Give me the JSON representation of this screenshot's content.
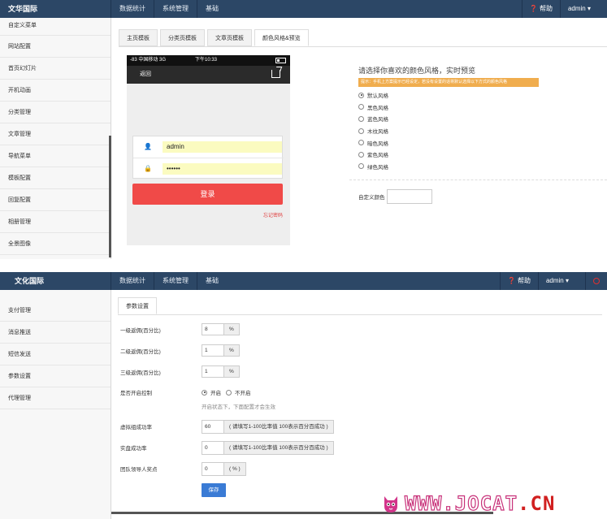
{
  "panel1": {
    "brand": "文华国际",
    "nav": [
      "数据统计",
      "系统管理",
      "基础"
    ],
    "help": "帮助",
    "user": "admin",
    "sidebar": [
      "自定义菜单",
      "网站配置",
      "首页幻灯片",
      "开机动画",
      "分类管理",
      "文章管理",
      "导航菜单",
      "模板配置",
      "回复配置",
      "相册管理",
      "全景图像"
    ],
    "tabs": [
      "主页模板",
      "分类页模板",
      "文章页模板",
      "颜色风格&预览"
    ],
    "phone": {
      "carrier": "-83 中国移动  3G",
      "time": "下午10:33",
      "back": "返回",
      "username": "admin",
      "password": "••••••",
      "login": "登录",
      "forgot": "忘记密码"
    },
    "picker": {
      "title": "请选择你喜欢的颜色风格，实时预览",
      "tip": "提示：手机上方案提示已经设定，若没有设置的话将默认选择以下方式的颜色风格",
      "options": [
        "默认风格",
        "黑色风格",
        "蓝色风格",
        "木纹风格",
        "暗色风格",
        "紫色风格",
        "绿色风格"
      ],
      "selected_index": 0,
      "custom_label": "自定义颜色"
    }
  },
  "panel2": {
    "brand": "文化国际",
    "nav": [
      "数据统计",
      "系统管理",
      "基础"
    ],
    "help": "帮助",
    "user": "admin",
    "sidebar": [
      "支付管理",
      "消息推送",
      "短信发送",
      "参数设置",
      "代理管理"
    ],
    "tab": "参数设置",
    "form": {
      "rows": [
        {
          "label": "一级返佣(百分比)",
          "value": "8",
          "addon": "%"
        },
        {
          "label": "二级返佣(百分比)",
          "value": "1",
          "addon": "%"
        },
        {
          "label": "三级返佣(百分比)",
          "value": "1",
          "addon": "%"
        }
      ],
      "switch_label": "是否开启控制",
      "switch_on": "开启",
      "switch_off": "不开启",
      "switch_note": "开启状态下，下面配置才会生效",
      "virtual_label": "虚拟组成功率",
      "virtual_value": "60",
      "virtual_addon": "( 请填写1-100比率值 100表示百分百成功 )",
      "real_label": "实盘成功率",
      "real_value": "0",
      "real_addon": "( 请填写1-100比率值 100表示百分百成功 )",
      "leader_label": "团队领导人奖点",
      "leader_value": "0",
      "leader_addon": "( % )",
      "save": "保存"
    }
  },
  "watermark": {
    "text": "WWW.JOCAT",
    "suffix": ".CN"
  }
}
